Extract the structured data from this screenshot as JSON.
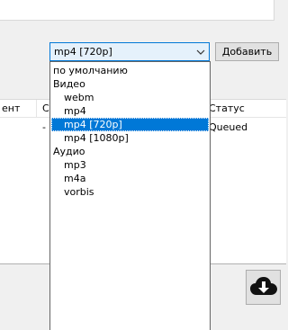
{
  "format": {
    "selected": "mp4 [720p]",
    "add_button_label": "Добавить",
    "options": [
      {
        "label": "по умолчанию",
        "indent": false,
        "selected": false
      },
      {
        "label": "Видео",
        "indent": false,
        "selected": false
      },
      {
        "label": "webm",
        "indent": true,
        "selected": false
      },
      {
        "label": "mp4",
        "indent": true,
        "selected": false
      },
      {
        "label": "mp4 [720p]",
        "indent": true,
        "selected": true
      },
      {
        "label": "mp4 [1080p]",
        "indent": true,
        "selected": false
      },
      {
        "label": "Аудио",
        "indent": false,
        "selected": false
      },
      {
        "label": "mp3",
        "indent": true,
        "selected": false
      },
      {
        "label": "m4a",
        "indent": true,
        "selected": false
      },
      {
        "label": "vorbis",
        "indent": true,
        "selected": false
      }
    ]
  },
  "table": {
    "headers": {
      "left_partial": "ент",
      "second_partial": "С",
      "status": "Статус"
    },
    "row": {
      "second_partial": "-",
      "status": "Queued"
    }
  },
  "icons": {
    "combo_arrow": "chevron-down-icon",
    "download": "cloud-download-icon"
  },
  "colors": {
    "accent": "#0078d7",
    "selection_text": "#ffffff",
    "window_bg": "#f0f0f0"
  }
}
